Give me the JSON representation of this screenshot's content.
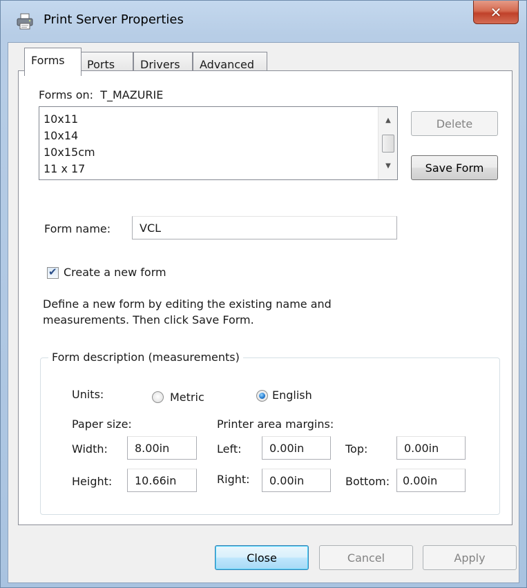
{
  "window": {
    "title": "Print Server Properties",
    "close_glyph": "✕"
  },
  "tabs": [
    {
      "label": "Forms",
      "active": true
    },
    {
      "label": "Ports",
      "active": false
    },
    {
      "label": "Drivers",
      "active": false
    },
    {
      "label": "Advanced",
      "active": false
    }
  ],
  "forms": {
    "forms_on_label": "Forms on:",
    "server_name": "T_MAZURIE",
    "list_items": [
      "10x11",
      "10x14",
      "10x15cm",
      "11 x 17"
    ],
    "delete_label": "Delete",
    "save_form_label": "Save Form",
    "form_name_label": "Form name:",
    "form_name_value": "VCL",
    "create_new_label": "Create a new form",
    "create_new_checked": true,
    "help_line1": "Define a new form by editing the existing name and",
    "help_line2": "measurements.  Then click Save Form."
  },
  "description": {
    "group_label": "Form description (measurements)",
    "units_label": "Units:",
    "metric_label": "Metric",
    "english_label": "English",
    "selected_unit": "English",
    "paper_size_label": "Paper size:",
    "margins_label": "Printer area margins:",
    "width_label": "Width:",
    "width_value": "8.00in",
    "height_label": "Height:",
    "height_value": "10.66in",
    "left_label": "Left:",
    "left_value": "0.00in",
    "right_label": "Right:",
    "right_value": "0.00in",
    "top_label": "Top:",
    "top_value": "0.00in",
    "bottom_label": "Bottom:",
    "bottom_value": "0.00in"
  },
  "footer": {
    "close_label": "Close",
    "cancel_label": "Cancel",
    "apply_label": "Apply"
  },
  "icons": {
    "title_icon": "printer-icon",
    "scroll_up": "▲",
    "scroll_down": "▼",
    "check": "✔"
  },
  "colors": {
    "titlebar": "#b7cde6",
    "close_button": "#c0412a",
    "default_button_border": "#3c7fb1"
  }
}
